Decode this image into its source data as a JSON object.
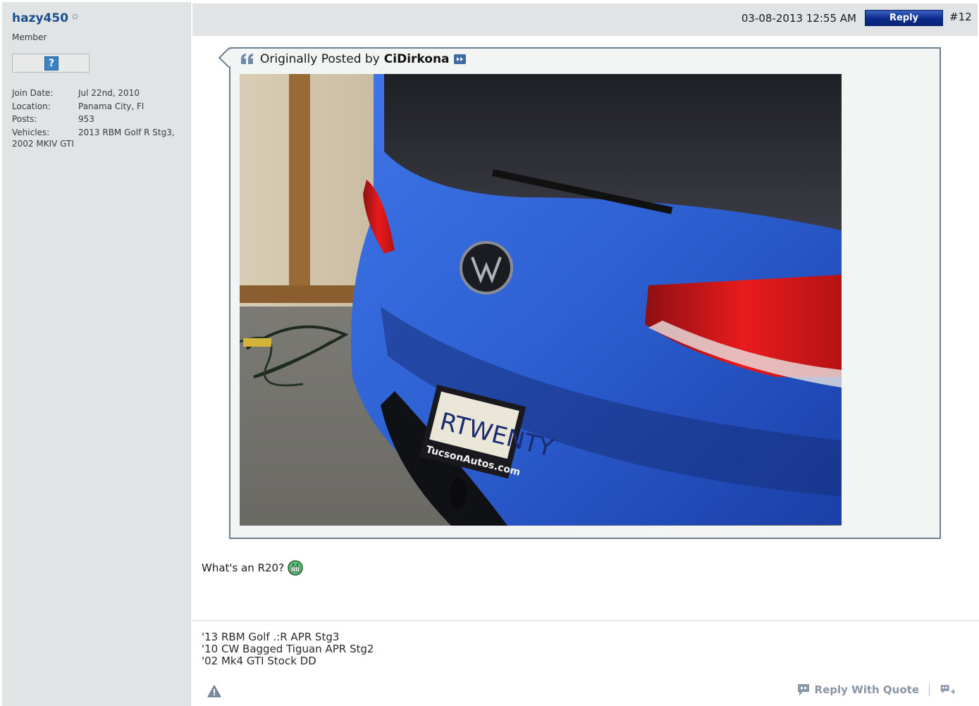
{
  "user": {
    "name": "hazy450",
    "title": "Member",
    "avatar_placeholder": "?",
    "details": {
      "join_label": "Join Date:",
      "join_value": "Jul 22nd, 2010",
      "location_label": "Location:",
      "location_value": "Panama City, Fl",
      "posts_label": "Posts:",
      "posts_value": "953",
      "vehicles_label": "Vehicles:",
      "vehicles_value": "2013 RBM Golf R Stg3,",
      "vehicles_value_2": "2002 MKIV GTI"
    }
  },
  "post": {
    "date": "03-08-2013 12:55 AM",
    "reply_label": "Reply",
    "number": "#12",
    "quote": {
      "prefix": "Originally Posted by",
      "author": "CiDirkona",
      "plate_text": "RTWENTY",
      "plate_frame_text": "TucsonAutos.com"
    },
    "message": "What's an R20?",
    "signature": [
      "'13 RBM Golf .:R APR Stg3",
      "'10 CW Bagged Tiguan APR Stg2",
      "'02 Mk4 GTI Stock DD"
    ],
    "reply_with_quote_label": "Reply With Quote"
  },
  "colors": {
    "username": "#1d4e8d",
    "reply_button": "#0b2a8a",
    "car_body": "#2d5fd1",
    "quote_border": "#6b7f8e"
  },
  "icons": {
    "quote": "quote-icon",
    "view_post": "arrow-icon",
    "smiley": "grin-icon",
    "report": "warning-icon",
    "reply_quote": "speech-bubble-icon",
    "multiquote": "multiquote-plus-icon",
    "online_status": "offline-dot-icon"
  }
}
